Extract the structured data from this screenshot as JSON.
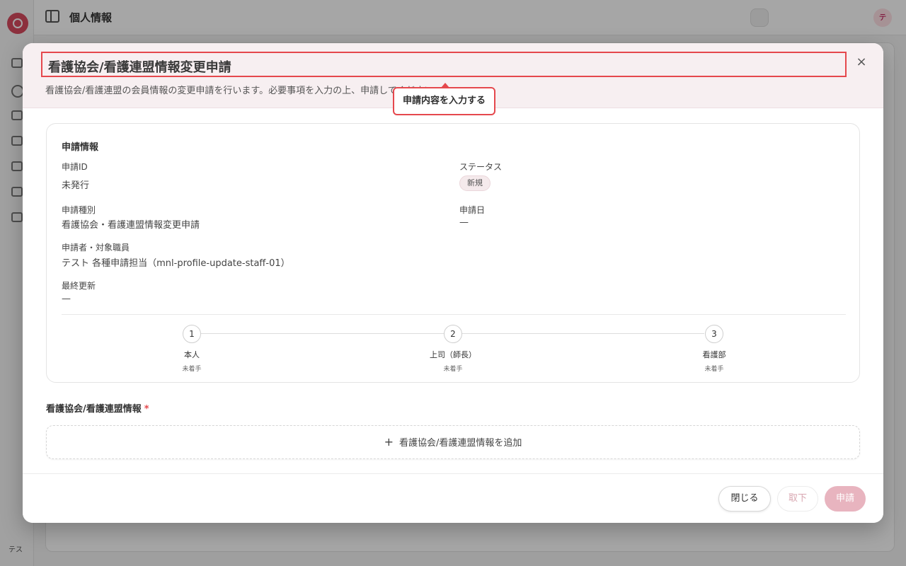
{
  "background": {
    "page_title": "個人情報",
    "sidebar_user": "テス",
    "avatar_initial": "テ"
  },
  "modal": {
    "title": "看護協会/看護連盟情報変更申請",
    "description": "看護協会/看護連盟の会員情報の変更申請を行います。必要事項を入力の上、申請してください。",
    "close_icon": "×",
    "tooltip": "申請内容を入力する",
    "application_info": {
      "section_title": "申請情報",
      "id_label": "申請ID",
      "id_value": "未発行",
      "status_label": "ステータス",
      "status_value": "新規",
      "type_label": "申請種別",
      "type_value": "看護協会・看護連盟情報変更申請",
      "date_label": "申請日",
      "date_value": "—",
      "applicant_label": "申請者・対象職員",
      "applicant_value": "テスト 各種申請担当（mnl-profile-update-staff-01）",
      "updated_label": "最終更新",
      "updated_value": "—"
    },
    "steps": [
      {
        "number": "1",
        "label": "本人",
        "status": "未着手"
      },
      {
        "number": "2",
        "label": "上司（師長）",
        "status": "未着手"
      },
      {
        "number": "3",
        "label": "看護部",
        "status": "未着手"
      }
    ],
    "nursing_section": {
      "label": "看護協会/看護連盟情報",
      "required": "*",
      "add_icon": "+",
      "add_button": "看護協会/看護連盟情報を追加"
    },
    "footer": {
      "close_button": "閉じる",
      "withdraw_button": "取下",
      "submit_button": "申請"
    }
  }
}
